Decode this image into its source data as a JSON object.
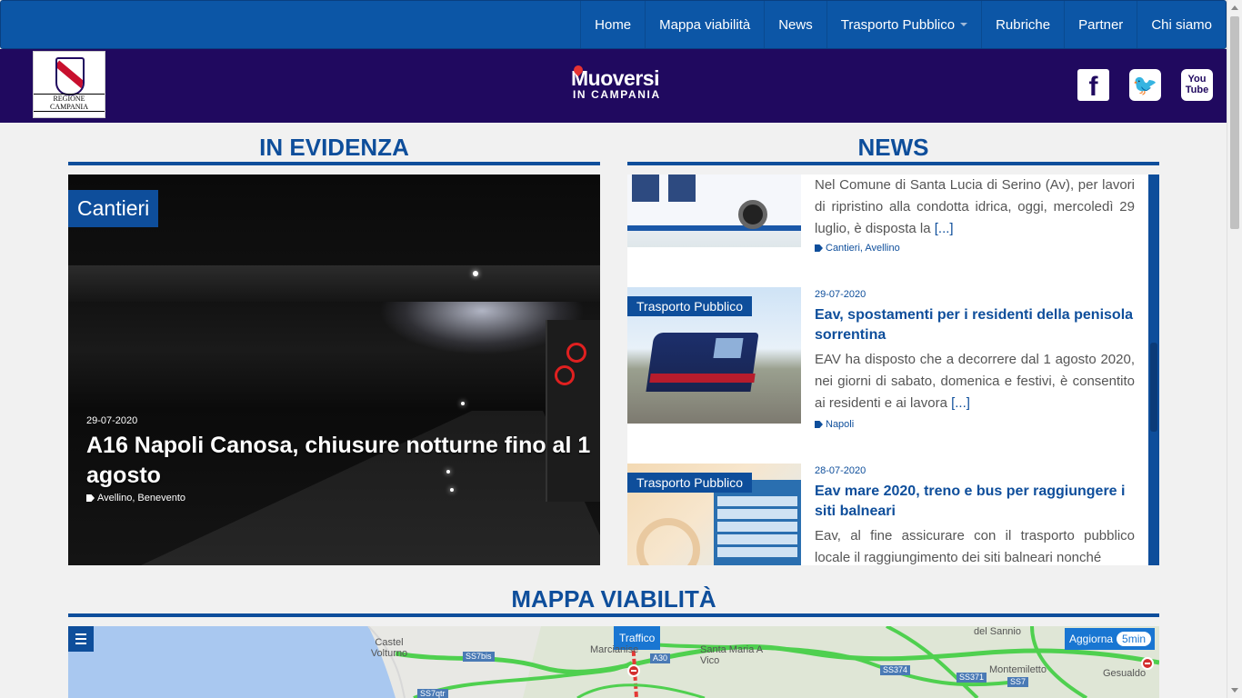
{
  "nav": {
    "items": [
      {
        "label": "Home"
      },
      {
        "label": "Mappa viabilità"
      },
      {
        "label": "News"
      },
      {
        "label": "Trasporto Pubblico"
      },
      {
        "label": "Rubriche"
      },
      {
        "label": "Partner"
      },
      {
        "label": "Chi siamo"
      }
    ]
  },
  "header": {
    "region_logo_text": "REGIONE CAMPANIA",
    "brand_line1": "Muoversi",
    "brand_line2": "IN CAMPANIA",
    "social": {
      "facebook": "f",
      "twitter": "🐦",
      "youtube_1": "You",
      "youtube_2": "Tube"
    }
  },
  "sections": {
    "evidenza": "IN EVIDENZA",
    "news": "NEWS",
    "mappa": "MAPPA VIABILITÀ"
  },
  "featured": {
    "category": "Cantieri",
    "date": "29-07-2020",
    "title": "A16 Napoli Canosa, chiusure notturne fino al 1 agosto",
    "tags": "Avellino, Benevento"
  },
  "news": {
    "items": [
      {
        "excerpt": "Nel Comune di Santa Lucia di Serino (Av), per lavori di ripristino alla condotta idrica, oggi, mercoledì 29 luglio, è disposta la",
        "more": "[...]",
        "tags": "Cantieri, Avellino"
      },
      {
        "badge": "Trasporto Pubblico",
        "date": "29-07-2020",
        "title": "Eav, spostamenti per i residenti della penisola sorrentina",
        "excerpt": "EAV ha disposto che a decorrere dal 1 agosto 2020, nei giorni di sabato, domenica e festivi, è consentito ai residenti e ai lavora",
        "more": "[...]",
        "tags": "Napoli"
      },
      {
        "badge": "Trasporto Pubblico",
        "date": "28-07-2020",
        "title": "Eav mare 2020, treno e bus per raggiungere i siti balneari",
        "excerpt": "Eav, al fine assicurare con il trasporto pubblico locale il raggiungimento dei siti balneari nonché"
      }
    ]
  },
  "map": {
    "traffico": "Traffico",
    "aggiorna": "Aggiorna",
    "interval": "5min",
    "places": [
      "Castel Volturno",
      "Marcianise",
      "Santa Maria A Vico",
      "del Sannio",
      "Montemiletto",
      "Gesualdo"
    ],
    "roads": [
      "SS7bis",
      "A30",
      "SS374",
      "SS371",
      "SS7",
      "SS7qtr"
    ]
  }
}
